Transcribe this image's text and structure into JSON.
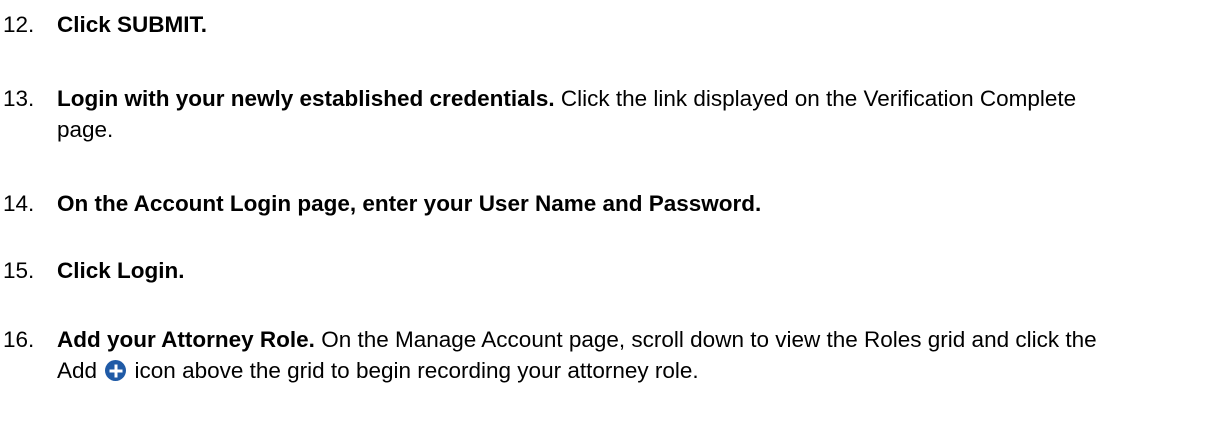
{
  "steps": [
    {
      "number": "12.",
      "title": "Click SUBMIT.",
      "text": ""
    },
    {
      "number": "13.",
      "title": "Login with your newly established credentials.",
      "text": " Click the link displayed on the Verification Complete page."
    },
    {
      "number": "14.",
      "title": "On the Account Login page, enter your User Name and Password.",
      "text": ""
    },
    {
      "number": "15.",
      "title": "Click Login.",
      "text": ""
    },
    {
      "number": "16.",
      "title": "Add your Attorney Role.",
      "text_before_icon": " On the Manage Account page, scroll down to view the Roles grid and click the Add ",
      "icon": "add-circle-icon",
      "text_after_icon": " icon above the grid to begin recording your attorney role."
    }
  ]
}
